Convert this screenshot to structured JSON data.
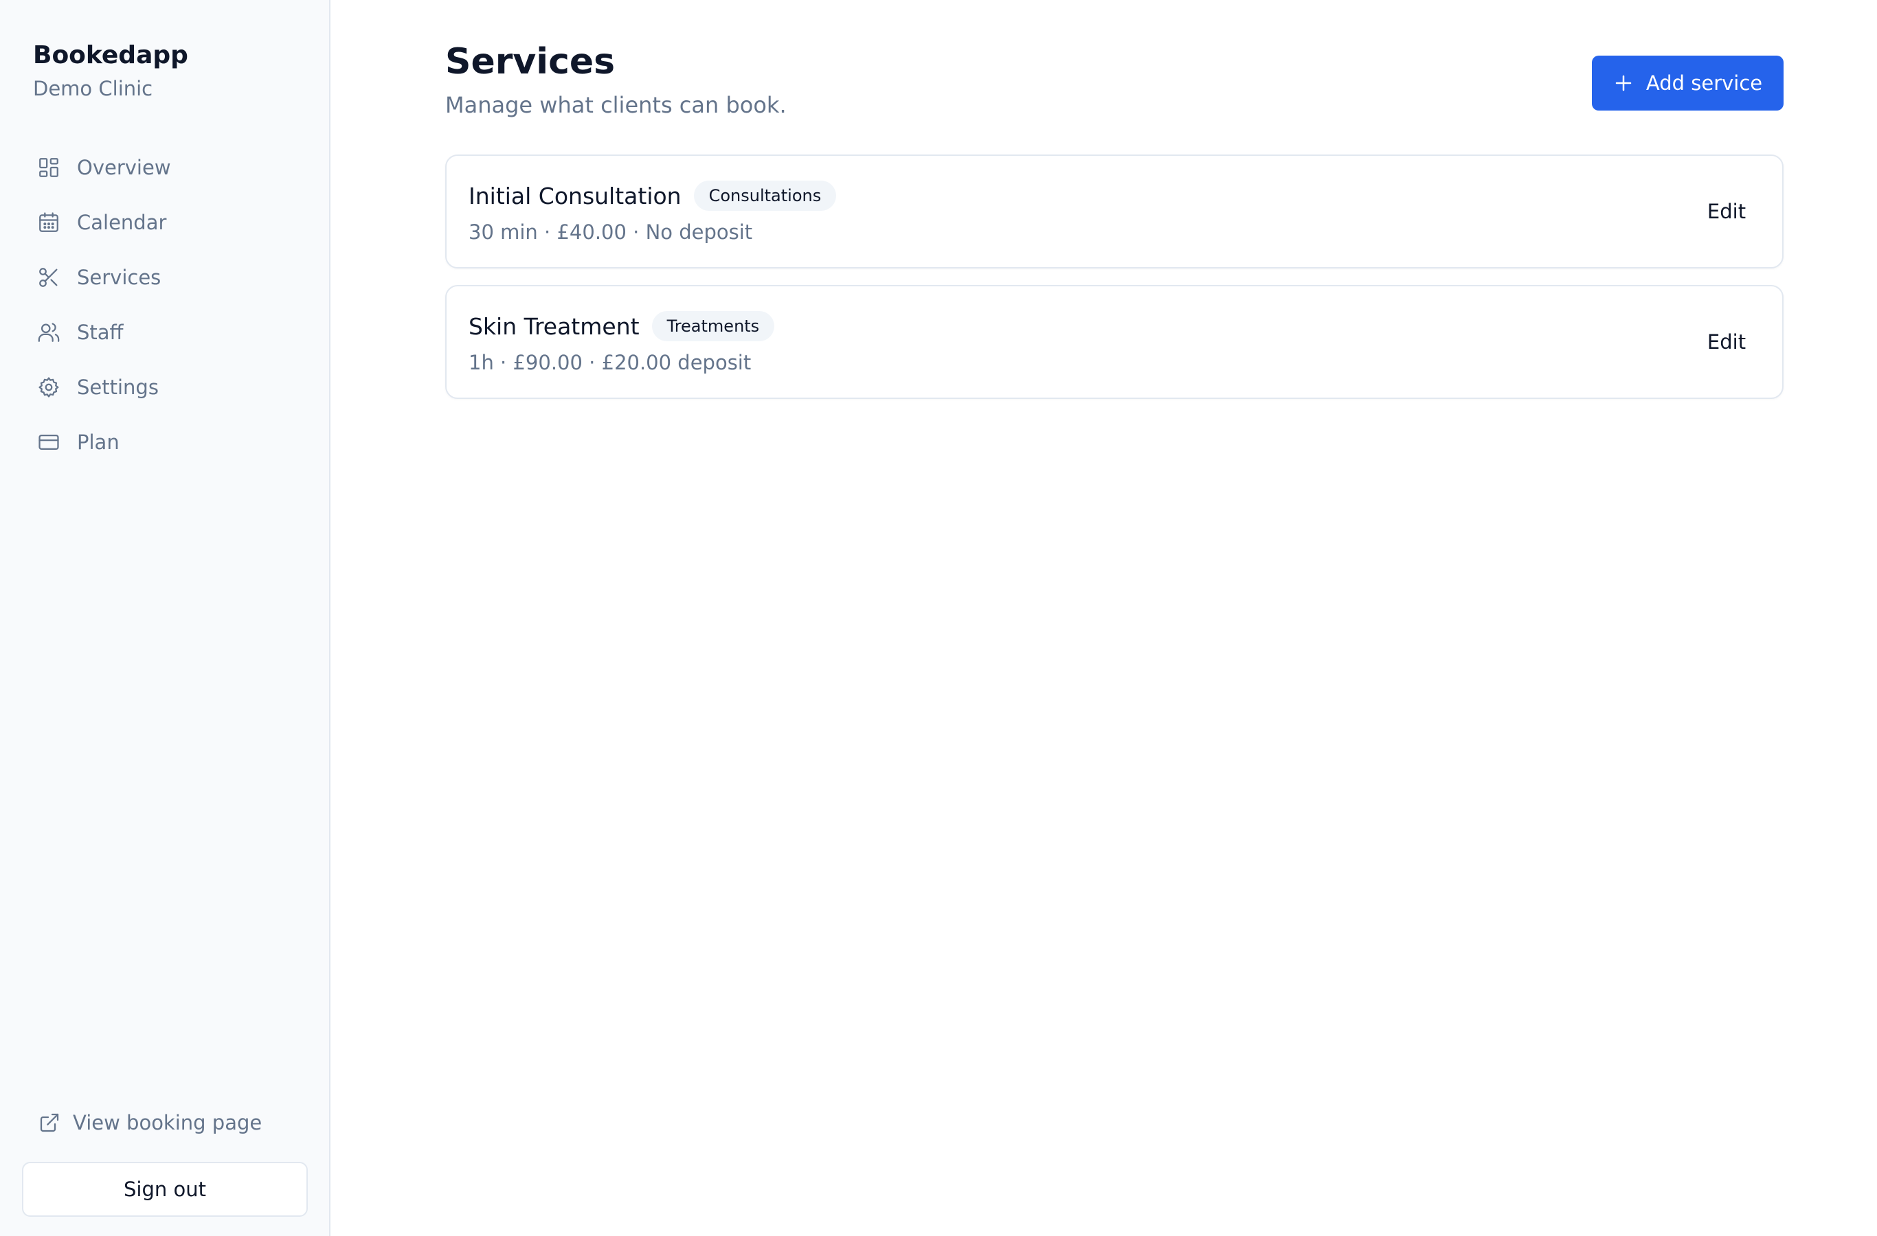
{
  "brand": {
    "name": "Bookedapp",
    "org": "Demo Clinic"
  },
  "sidebar": {
    "items": [
      {
        "label": "Overview",
        "icon": "layout-grid-icon"
      },
      {
        "label": "Calendar",
        "icon": "calendar-icon"
      },
      {
        "label": "Services",
        "icon": "scissors-icon"
      },
      {
        "label": "Staff",
        "icon": "users-icon"
      },
      {
        "label": "Settings",
        "icon": "gear-icon"
      },
      {
        "label": "Plan",
        "icon": "credit-card-icon"
      }
    ],
    "view_booking_label": "View booking page",
    "sign_out_label": "Sign out"
  },
  "header": {
    "title": "Services",
    "subtitle": "Manage what clients can book.",
    "add_label": "Add service"
  },
  "services": [
    {
      "name": "Initial Consultation",
      "category": "Consultations",
      "meta": "30 min · £40.00 · No deposit",
      "edit_label": "Edit"
    },
    {
      "name": "Skin Treatment",
      "category": "Treatments",
      "meta": "1h · £90.00 · £20.00 deposit",
      "edit_label": "Edit"
    }
  ],
  "colors": {
    "accent": "#2563eb",
    "muted_text": "#64748b",
    "sidebar_bg": "#f8fafc",
    "border": "#e2e8f0"
  }
}
